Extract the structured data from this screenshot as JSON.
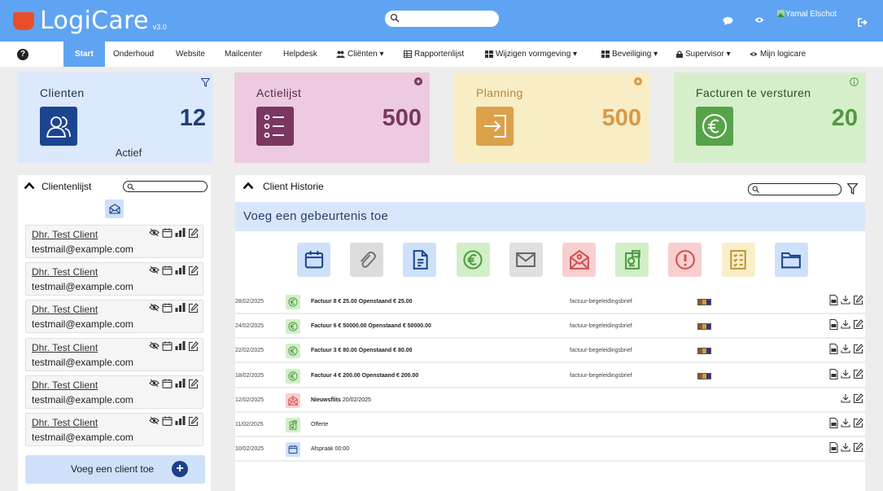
{
  "app": {
    "name": "LogiCare",
    "version": "v3.0",
    "user": "Yamal Elschot"
  },
  "nav": {
    "help": "?",
    "items": [
      "Start",
      "Onderhoud",
      "Website",
      "Mailcenter",
      "Helpdesk",
      "Cliënten ▾",
      "Rapportenlijst",
      "Wijzigen vormgeving ▾",
      "Beveiliging ▾",
      "Supervisor ▾",
      "Mijn logicare"
    ]
  },
  "stats": [
    {
      "label": "Clienten",
      "value": "12",
      "sub": "Actief",
      "bg": "#dce8fb",
      "icon_bg": "#1c4591",
      "color": "#1c3f7a",
      "icon": "users-icon"
    },
    {
      "label": "Actielijst",
      "value": "500",
      "sub": "",
      "bg": "#eccbe0",
      "icon_bg": "#7a3760",
      "color": "#7a3760",
      "icon": "list-icon"
    },
    {
      "label": "Planning",
      "value": "500",
      "sub": "",
      "bg": "#f8edc5",
      "icon_bg": "#dba14a",
      "color": "#d59a44",
      "icon": "sign-in-icon"
    },
    {
      "label": "Facturen te versturen",
      "value": "20",
      "sub": "",
      "bg": "#d6efcb",
      "icon_bg": "#56a34a",
      "color": "#4f9a42",
      "icon": "euro-icon"
    }
  ],
  "clientlist": {
    "title": "Clientenlijst",
    "clients": [
      {
        "name": "Dhr. Test Client",
        "email": "testmail@example.com"
      },
      {
        "name": "Dhr. Test Client",
        "email": "testmail@example.com"
      },
      {
        "name": "Dhr. Test Client",
        "email": "testmail@example.com"
      },
      {
        "name": "Dhr. Test Client",
        "email": "testmail@example.com"
      },
      {
        "name": "Dhr. Test Client",
        "email": "testmail@example.com"
      },
      {
        "name": "Dhr. Test Client",
        "email": "testmail@example.com"
      }
    ],
    "add_label": "Voeg een client toe"
  },
  "history": {
    "title": "Client Historie",
    "add_event": "Voeg een gebeurtenis toe",
    "event_buttons": [
      {
        "icon": "calendar-icon",
        "bg": "#cfe0fa"
      },
      {
        "icon": "paperclip-icon",
        "bg": "#dcdcdc"
      },
      {
        "icon": "document-icon",
        "bg": "#cfe0fa"
      },
      {
        "icon": "euro-icon",
        "bg": "#d1efc8"
      },
      {
        "icon": "envelope-icon",
        "bg": "#e0e0e0"
      },
      {
        "icon": "newsletter-icon",
        "bg": "#f8cfcf"
      },
      {
        "icon": "quote-icon",
        "bg": "#d1efc8"
      },
      {
        "icon": "alert-icon",
        "bg": "#f8cfcf"
      },
      {
        "icon": "checklist-icon",
        "bg": "#f8eec8"
      },
      {
        "icon": "folder-icon",
        "bg": "#cfe0fa"
      }
    ],
    "rows": [
      {
        "date": "28/02/2025",
        "icon": "euro-icon",
        "icon_bg": "#d1efc8",
        "title": "Factuur 8 € 25.00  Openstaand € 25.00",
        "doc": "factuur-begeleidingsbrief",
        "flag": true,
        "actions": 3
      },
      {
        "date": "24/02/2025",
        "icon": "euro-icon",
        "icon_bg": "#d1efc8",
        "title": "Factuur 6 € 50000.00  Openstaand € 50000.00",
        "doc": "factuur-begeleidingsbrief",
        "flag": true,
        "actions": 3
      },
      {
        "date": "22/02/2025",
        "icon": "euro-icon",
        "icon_bg": "#d1efc8",
        "title": "Factuur 3 € 80.00  Openstaand € 80.00",
        "doc": "factuur-begeleidingsbrief",
        "flag": true,
        "actions": 3
      },
      {
        "date": "18/02/2025",
        "icon": "euro-icon",
        "icon_bg": "#d1efc8",
        "title": "Factuur 4 € 200.00  Openstaand € 200.00",
        "doc": "factuur-begeleidingsbrief",
        "flag": true,
        "actions": 3
      },
      {
        "date": "12/02/2025",
        "icon": "newsletter-icon",
        "icon_bg": "#f8cfcf",
        "title": "Nieuwsflits",
        "extra": "20/02/2025",
        "doc": "",
        "flag": false,
        "actions": 2
      },
      {
        "date": "11/02/2025",
        "icon": "quote-icon",
        "icon_bg": "#d1efc8",
        "title": "",
        "extra": "Offerte",
        "doc": "",
        "flag": false,
        "actions": 3
      },
      {
        "date": "10/02/2025",
        "icon": "calendar-icon",
        "icon_bg": "#cfe0fa",
        "title": "",
        "extra": "Afspraak 00:00",
        "doc": "",
        "flag": false,
        "actions": 3
      }
    ]
  }
}
